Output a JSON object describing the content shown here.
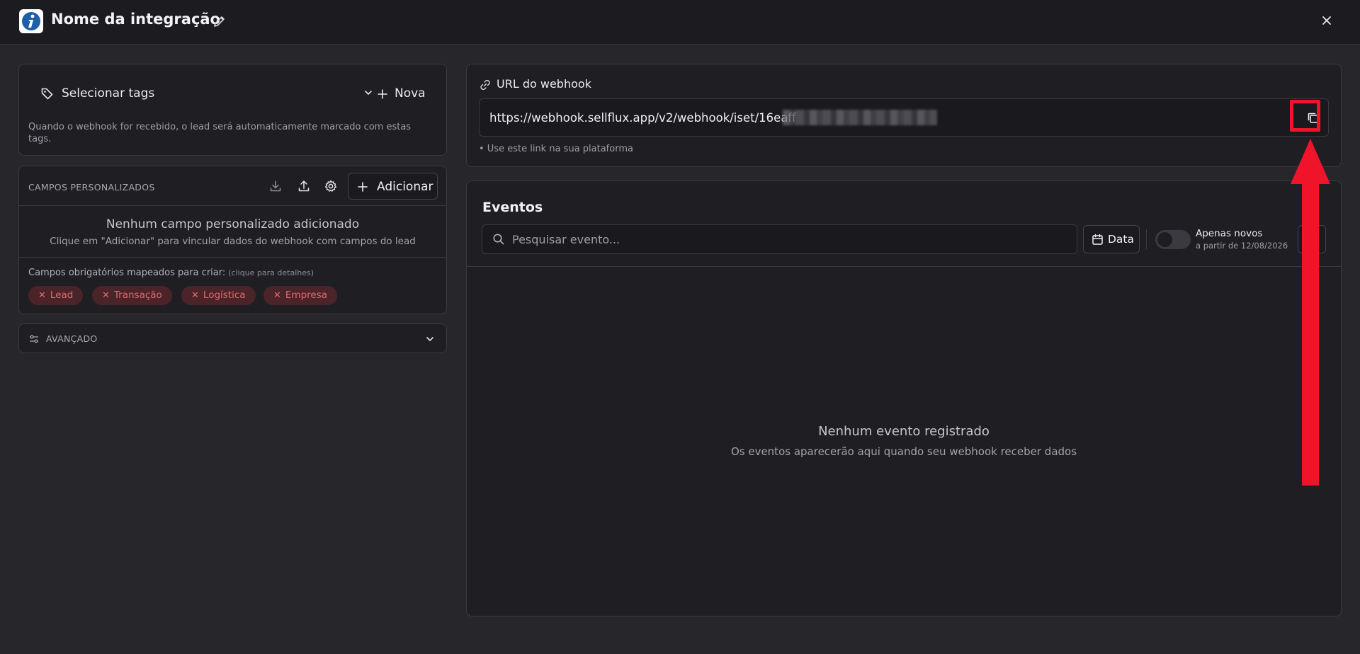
{
  "header": {
    "title": "Nome da integração"
  },
  "tags": {
    "select_label": "Selecionar tags",
    "new_label": "Nova",
    "hint": "Quando o webhook for recebido, o lead será automaticamente marcado com estas tags."
  },
  "campos": {
    "title": "CAMPOS PERSONALIZADOS",
    "add_label": "Adicionar",
    "empty_title": "Nenhum campo personalizado adicionado",
    "empty_sub": "Clique em \"Adicionar\" para vincular dados do webhook com campos do lead",
    "required_label": "Campos obrigatórios mapeados para criar:",
    "required_hint": "(clique para detalhes)",
    "chips": [
      "Lead",
      "Transação",
      "Logística",
      "Empresa"
    ],
    "chip_color": "#e06a70"
  },
  "advanced": {
    "label": "AVANÇADO"
  },
  "webhook": {
    "title": "URL do webhook",
    "url": "https://webhook.sellflux.app/v2/webhook/iset/16eaff",
    "hint": "• Use este link na sua plataforma",
    "highlight_color": "#f0142b"
  },
  "events": {
    "title": "Eventos",
    "search_placeholder": "Pesquisar evento...",
    "date_label": "Data",
    "toggle_label": "Apenas novos",
    "toggle_sub": "a partir de 12/08/2026",
    "empty_title": "Nenhum evento registrado",
    "empty_sub": "Os eventos aparecerão aqui quando seu webhook receber dados"
  }
}
